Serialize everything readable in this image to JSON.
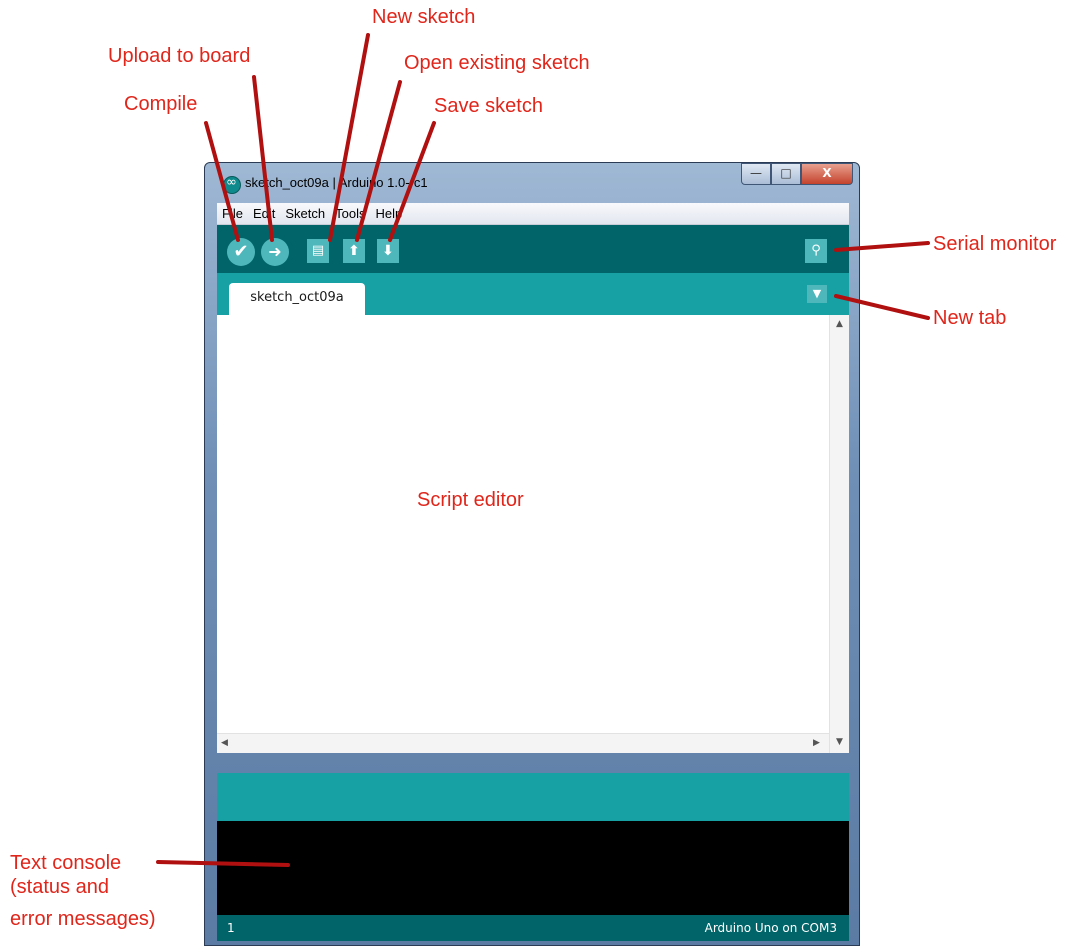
{
  "annotations": {
    "compile": "Compile",
    "upload": "Upload to board",
    "new_sketch": "New sketch",
    "open_sketch": "Open existing sketch",
    "save_sketch": "Save sketch",
    "serial_monitor": "Serial monitor",
    "new_tab": "New tab",
    "script_editor": "Script editor",
    "text_console_1": "Text console",
    "text_console_2": "(status and",
    "text_console_3": "error messages)"
  },
  "window": {
    "title": "sketch_oct09a | Arduino 1.0-rc1",
    "controls": {
      "minimize": "—",
      "maximize": "□",
      "close": "X"
    }
  },
  "menu": [
    "File",
    "Edit",
    "Sketch",
    "Tools",
    "Help"
  ],
  "toolbar": {
    "compile_icon": "check-icon",
    "upload_icon": "arrow-right-icon",
    "new_icon": "document-icon",
    "open_icon": "arrow-up-icon",
    "save_icon": "arrow-down-icon",
    "serial_icon": "magnifier-icon"
  },
  "tabs": {
    "active": "sketch_oct09a",
    "menu_glyph": "▼"
  },
  "footer": {
    "line_number": "1",
    "board": "Arduino Uno on COM3"
  },
  "colors": {
    "annotation": "#e0261b",
    "toolbar": "#006468",
    "tabbar": "#17a1a5",
    "console": "#000000"
  }
}
